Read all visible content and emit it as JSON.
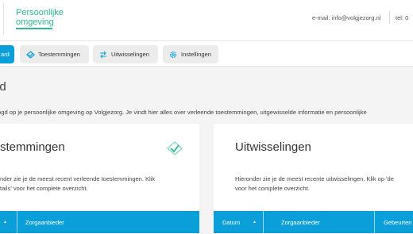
{
  "header": {
    "brand_line1": "Persoonlijke",
    "brand_line2": "omgeving",
    "email": "e-mail: info@volgjezorg.nl",
    "phone": "tel: 0"
  },
  "nav": {
    "tabs": [
      {
        "label": "ard",
        "icon": "",
        "active": true
      },
      {
        "label": "Toestemmingen",
        "icon": "shield-check-icon"
      },
      {
        "label": "Uitwisselingen",
        "icon": "exchange-icon"
      },
      {
        "label": "Instellingen",
        "icon": "gear-icon"
      }
    ]
  },
  "main": {
    "title": "ard",
    "intro": "ogd op je persoonlijke omgeving op Volgjezorg. Je vindt hier alles over verleende toestemmingen, uitgewisselde informatie en persoonlijke"
  },
  "cards": {
    "toestemmingen": {
      "title": "stemmingen",
      "desc_line1": "nder zie je de meest recent verleende toestemmingen. Klik",
      "desc_line2": "tails' voor het complete overzicht.",
      "columns": [
        "▲",
        "Zorgaanbieder"
      ]
    },
    "uitwisselingen": {
      "title": "Uitwisselingen",
      "desc_line1": "Hieronder zie je de meest recente uitwisselingen. Klik op 'de",
      "desc_line2": "voor het complete overzicht.",
      "columns": [
        "Datum",
        "▲",
        "Zorgaanbieder",
        "Gebeurten"
      ]
    }
  },
  "colors": {
    "accent_blue": "#0a9fd9",
    "brand_green": "#2eb89a"
  }
}
